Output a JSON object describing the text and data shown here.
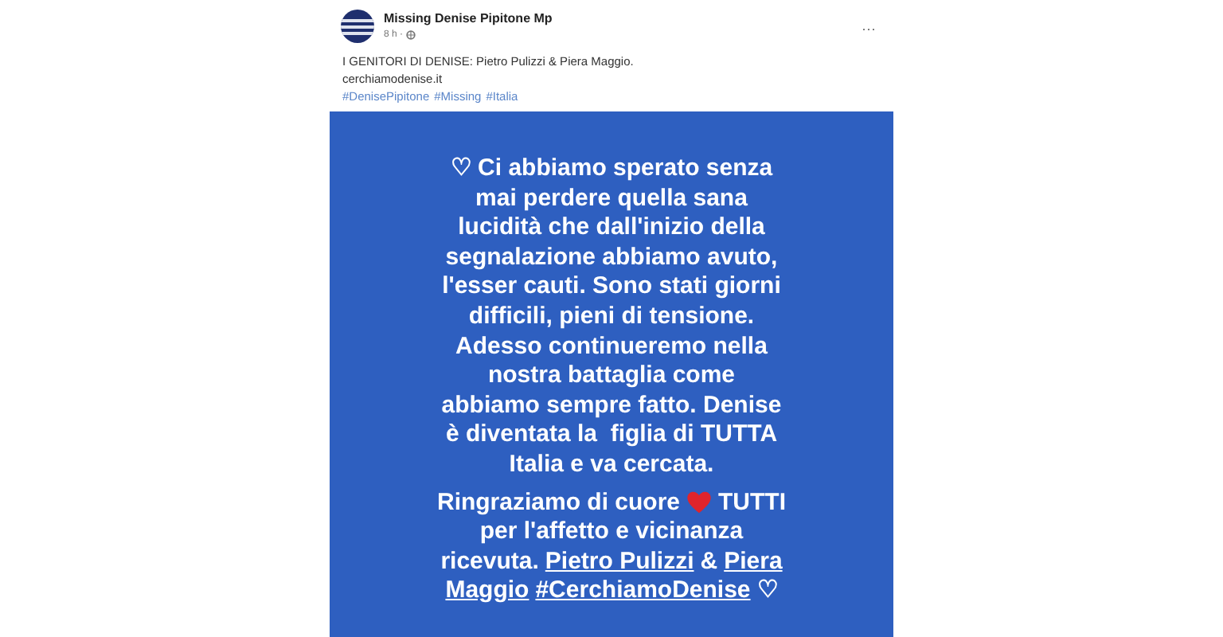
{
  "post": {
    "page_name": "Missing Denise Pipitone Mp",
    "time": "8 h ·",
    "menu": "···",
    "text_lines": [
      "I GENITORI DI DENISE: Pietro Pulizzi & Piera Maggio.",
      "cerchiamodenise.it"
    ],
    "hashtags": [
      "#DenisePipitone",
      "#Missing",
      "#Italia"
    ]
  },
  "image": {
    "paragraphs": [
      {
        "lines": [
          [
            {
              "kind": "text",
              "text": "♡ Ci abbiamo sperato senza"
            }
          ],
          [
            {
              "kind": "text",
              "text": "mai perdere quella sana"
            }
          ],
          [
            {
              "kind": "text",
              "text": "lucidità che dall'inizio della"
            }
          ],
          [
            {
              "kind": "text",
              "text": "segnalazione abbiamo avuto,"
            }
          ],
          [
            {
              "kind": "text",
              "text": "l'esser cauti. Sono stati giorni"
            }
          ],
          [
            {
              "kind": "text",
              "text": "difficili, pieni di tensione."
            }
          ],
          [
            {
              "kind": "text",
              "text": "Adesso continueremo nella"
            }
          ],
          [
            {
              "kind": "text",
              "text": "nostra battaglia come"
            }
          ],
          [
            {
              "kind": "text",
              "text": "abbiamo sempre fatto. Denise"
            }
          ],
          [
            {
              "kind": "text",
              "text": "è diventata la  figlia di TUTTA"
            }
          ],
          [
            {
              "kind": "text",
              "text": "Italia e va cercata."
            }
          ]
        ]
      },
      {
        "lines": [
          [
            {
              "kind": "text",
              "text": "Ringraziamo di cuore"
            },
            {
              "kind": "heart"
            },
            {
              "kind": "text",
              "text": "TUTTI"
            }
          ],
          [
            {
              "kind": "text",
              "text": "per l'affetto e vicinanza"
            }
          ],
          [
            {
              "kind": "text",
              "text": "ricevuta."
            },
            {
              "kind": "link",
              "text": "Pietro Pulizzi"
            },
            {
              "kind": "text",
              "text": "&"
            },
            {
              "kind": "link",
              "text": "Piera"
            }
          ],
          [
            {
              "kind": "link",
              "text": "Maggio"
            },
            {
              "kind": "link",
              "text": "#CerchiamoDenise"
            },
            {
              "kind": "text",
              "text": "♡"
            }
          ]
        ]
      }
    ]
  }
}
